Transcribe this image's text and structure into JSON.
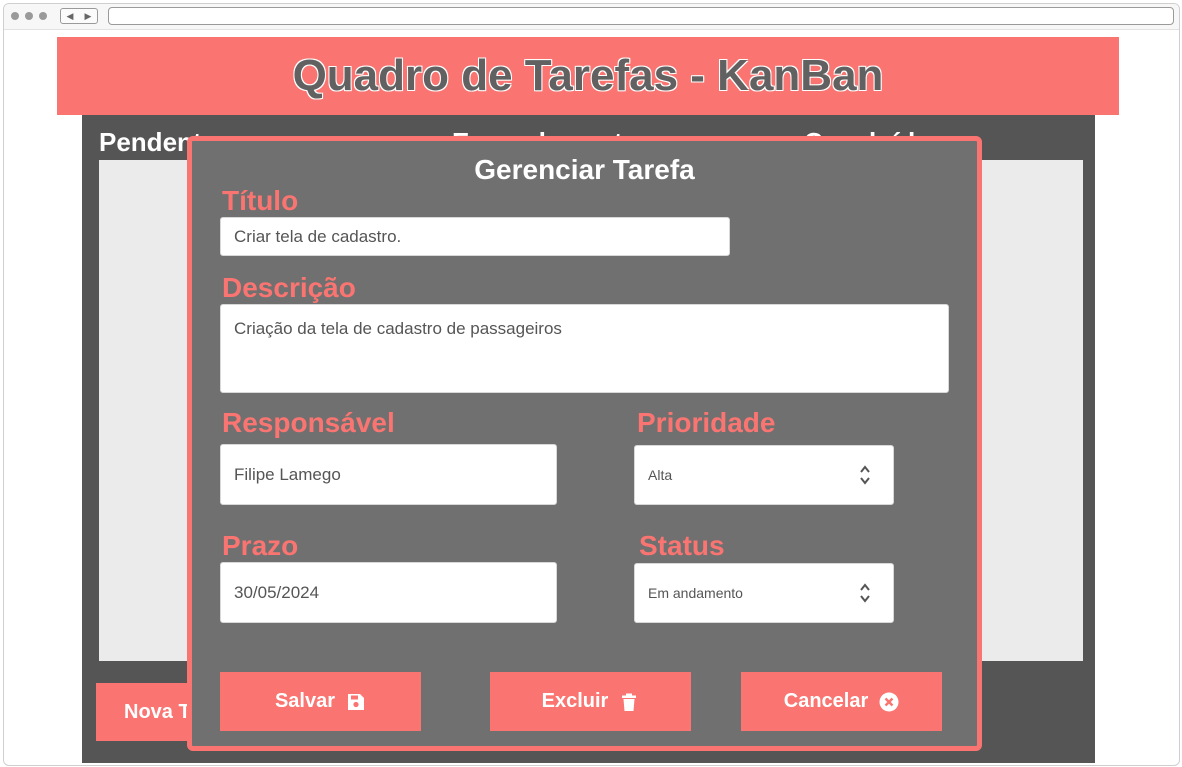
{
  "page": {
    "title": "Quadro de Tarefas - KanBan"
  },
  "board": {
    "columns": [
      {
        "label": "Pendentes"
      },
      {
        "label": "Em andamento"
      },
      {
        "label": "Concluídas"
      }
    ],
    "new_task_label": "Nova Tarefa"
  },
  "modal": {
    "title": "Gerenciar Tarefa",
    "fields": {
      "titulo": {
        "label": "Título",
        "value": "Criar tela de cadastro."
      },
      "descricao": {
        "label": "Descrição",
        "value": "Criação da tela de cadastro de passageiros"
      },
      "responsavel": {
        "label": "Responsável",
        "value": "Filipe Lamego"
      },
      "prioridade": {
        "label": "Prioridade",
        "value": "Alta"
      },
      "prazo": {
        "label": "Prazo",
        "value": "30/05/2024"
      },
      "status": {
        "label": "Status",
        "value": "Em andamento"
      }
    },
    "buttons": {
      "save": {
        "label": "Salvar",
        "icon": "floppy-disk-icon"
      },
      "delete": {
        "label": "Excluir",
        "icon": "trash-icon"
      },
      "cancel": {
        "label": "Cancelar",
        "icon": "circle-x-icon"
      }
    }
  },
  "colors": {
    "accent": "#fa7571",
    "board_background": "#555555",
    "modal_background": "#707070",
    "column_background": "#ebebeb"
  }
}
